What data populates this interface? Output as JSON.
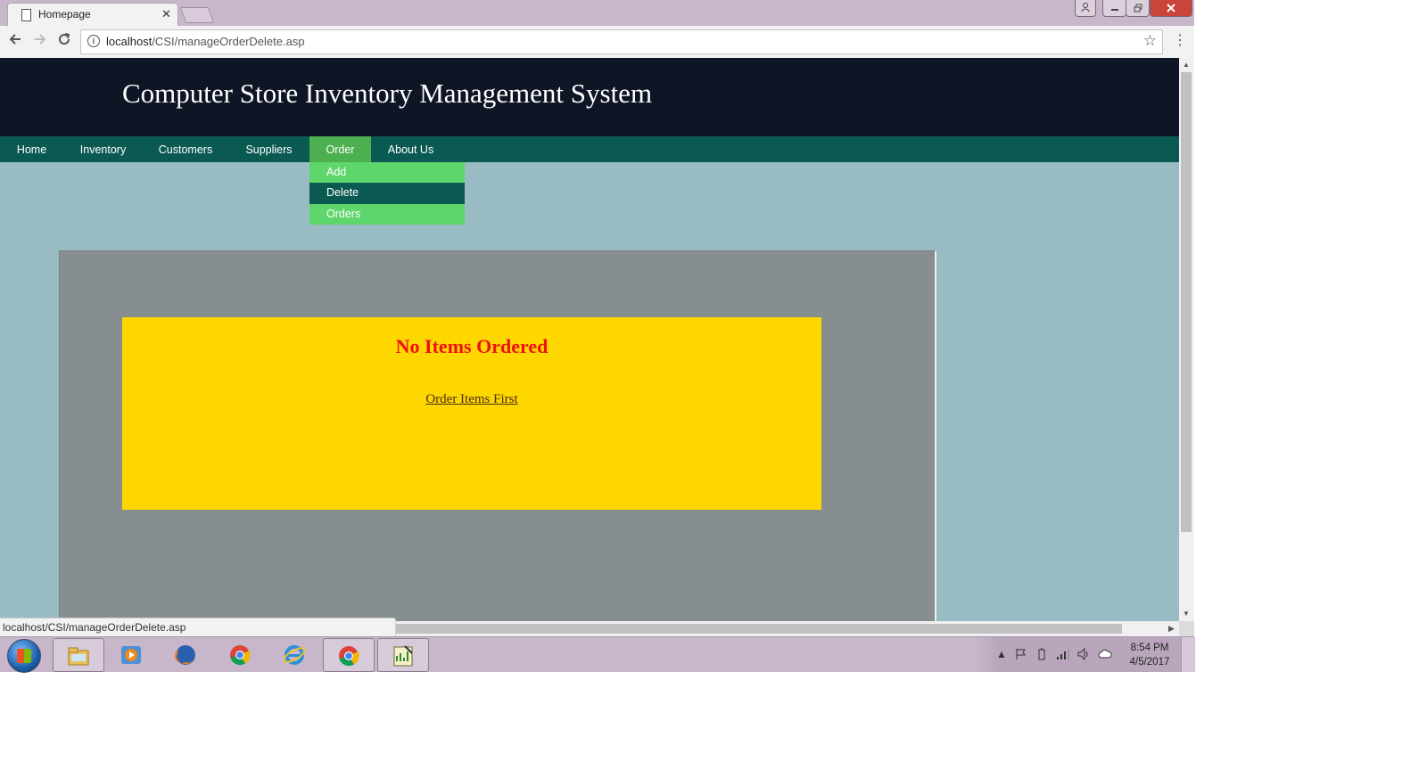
{
  "browser": {
    "tab_title": "Homepage",
    "tab_close": "✕",
    "url_host": "localhost",
    "url_path": "/CSI/manageOrderDelete.asp",
    "status_url": "localhost/CSI/manageOrderDelete.asp"
  },
  "site": {
    "title": "Computer Store Inventory Management System",
    "nav": [
      {
        "label": "Home"
      },
      {
        "label": "Inventory"
      },
      {
        "label": "Customers"
      },
      {
        "label": "Suppliers"
      },
      {
        "label": "Order"
      },
      {
        "label": "About Us"
      }
    ],
    "order_menu": [
      {
        "label": "Add"
      },
      {
        "label": "Delete"
      },
      {
        "label": "Orders"
      }
    ]
  },
  "message": {
    "heading": "No Items Ordered",
    "link": "Order Items First"
  },
  "taskbar": {
    "time": "8:54 PM",
    "date": "4/5/2017",
    "apps": [
      "file-explorer-icon",
      "media-player-icon",
      "firefox-icon",
      "chrome-icon",
      "internet-explorer-icon",
      "chrome-active-icon",
      "notepad-app-icon"
    ]
  },
  "colors": {
    "header_bg": "#0e1525",
    "nav_bg": "#0b5a52",
    "nav_active": "#4caf50",
    "dropdown_bg": "#5ed66b",
    "page_bg": "#99bbc3",
    "content_bg": "#868e8f",
    "message_bg": "#ffd700",
    "message_heading": "#ee1111"
  }
}
